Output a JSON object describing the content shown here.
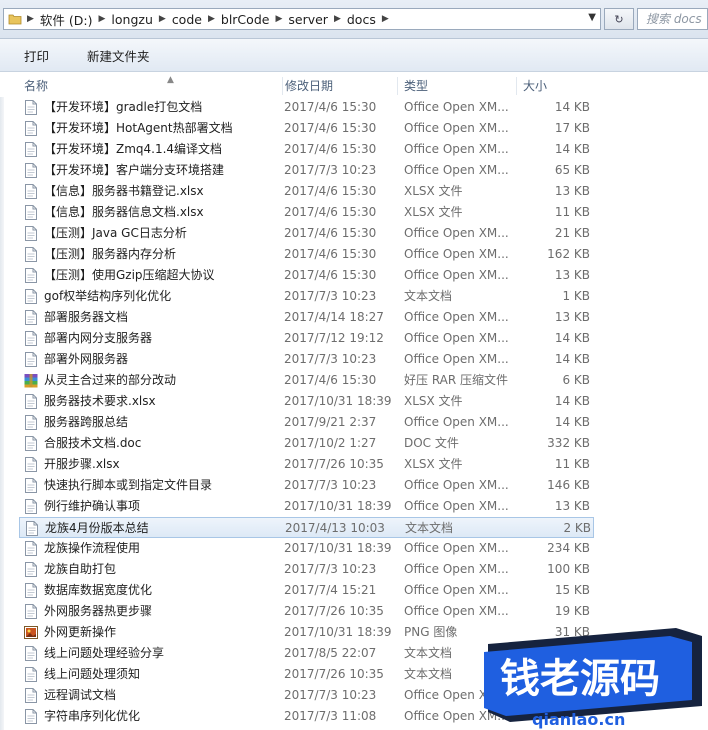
{
  "address": {
    "crumbs": [
      "软件 (D:)",
      "longzu",
      "code",
      "blrCode",
      "server",
      "docs"
    ]
  },
  "search": {
    "placeholder": "搜索 docs"
  },
  "toolbar": {
    "print_label": "打印",
    "new_folder_label": "新建文件夹"
  },
  "columns": {
    "name": "名称",
    "date": "修改日期",
    "type": "类型",
    "size": "大小"
  },
  "files": [
    {
      "name": "【开发环境】gradle打包文档",
      "date": "2017/4/6 15:30",
      "type": "Office Open XM...",
      "size": "14 KB",
      "icon": "document-icon"
    },
    {
      "name": "【开发环境】HotAgent热部署文档",
      "date": "2017/4/6 15:30",
      "type": "Office Open XM...",
      "size": "17 KB",
      "icon": "document-icon"
    },
    {
      "name": "【开发环境】Zmq4.1.4编译文档",
      "date": "2017/4/6 15:30",
      "type": "Office Open XM...",
      "size": "14 KB",
      "icon": "document-icon"
    },
    {
      "name": "【开发环境】客户端分支环境搭建",
      "date": "2017/7/3 10:23",
      "type": "Office Open XM...",
      "size": "65 KB",
      "icon": "document-icon"
    },
    {
      "name": "【信息】服务器书籍登记.xlsx",
      "date": "2017/4/6 15:30",
      "type": "XLSX 文件",
      "size": "13 KB",
      "icon": "document-icon"
    },
    {
      "name": "【信息】服务器信息文档.xlsx",
      "date": "2017/4/6 15:30",
      "type": "XLSX 文件",
      "size": "11 KB",
      "icon": "document-icon"
    },
    {
      "name": "【压测】Java GC日志分析",
      "date": "2017/4/6 15:30",
      "type": "Office Open XM...",
      "size": "21 KB",
      "icon": "document-icon"
    },
    {
      "name": "【压测】服务器内存分析",
      "date": "2017/4/6 15:30",
      "type": "Office Open XM...",
      "size": "162 KB",
      "icon": "document-icon"
    },
    {
      "name": "【压测】使用Gzip压缩超大协议",
      "date": "2017/4/6 15:30",
      "type": "Office Open XM...",
      "size": "13 KB",
      "icon": "document-icon"
    },
    {
      "name": "gof权举结构序列化优化",
      "date": "2017/7/3 10:23",
      "type": "文本文档",
      "size": "1 KB",
      "icon": "document-icon"
    },
    {
      "name": "部署服务器文档",
      "date": "2017/4/14 18:27",
      "type": "Office Open XM...",
      "size": "13 KB",
      "icon": "document-icon"
    },
    {
      "name": "部署内网分支服务器",
      "date": "2017/7/12 19:12",
      "type": "Office Open XM...",
      "size": "14 KB",
      "icon": "document-icon"
    },
    {
      "name": "部署外网服务器",
      "date": "2017/7/3 10:23",
      "type": "Office Open XM...",
      "size": "14 KB",
      "icon": "document-icon"
    },
    {
      "name": "从灵主合过来的部分改动",
      "date": "2017/4/6 15:30",
      "type": "好压 RAR 压缩文件",
      "size": "6 KB",
      "icon": "archive-icon"
    },
    {
      "name": "服务器技术要求.xlsx",
      "date": "2017/10/31 18:39",
      "type": "XLSX 文件",
      "size": "14 KB",
      "icon": "document-icon"
    },
    {
      "name": "服务器跨服总结",
      "date": "2017/9/21 2:37",
      "type": "Office Open XM...",
      "size": "14 KB",
      "icon": "document-icon"
    },
    {
      "name": "合服技术文档.doc",
      "date": "2017/10/2 1:27",
      "type": "DOC 文件",
      "size": "332 KB",
      "icon": "document-icon"
    },
    {
      "name": "开服步骤.xlsx",
      "date": "2017/7/26 10:35",
      "type": "XLSX 文件",
      "size": "11 KB",
      "icon": "document-icon"
    },
    {
      "name": "快速执行脚本或到指定文件目录",
      "date": "2017/7/3 10:23",
      "type": "Office Open XM...",
      "size": "146 KB",
      "icon": "document-icon"
    },
    {
      "name": "例行维护确认事项",
      "date": "2017/10/31 18:39",
      "type": "Office Open XM...",
      "size": "13 KB",
      "icon": "document-icon"
    },
    {
      "name": "龙族4月份版本总结",
      "date": "2017/4/13 10:03",
      "type": "文本文档",
      "size": "2 KB",
      "icon": "document-icon",
      "selected": true
    },
    {
      "name": "龙族操作流程使用",
      "date": "2017/10/31 18:39",
      "type": "Office Open XM...",
      "size": "234 KB",
      "icon": "document-icon"
    },
    {
      "name": "龙族自助打包",
      "date": "2017/7/3 10:23",
      "type": "Office Open XM...",
      "size": "100 KB",
      "icon": "document-icon"
    },
    {
      "name": "数据库数据宽度优化",
      "date": "2017/7/4 15:21",
      "type": "Office Open XM...",
      "size": "15 KB",
      "icon": "document-icon"
    },
    {
      "name": "外网服务器热更步骤",
      "date": "2017/7/26 10:35",
      "type": "Office Open XM...",
      "size": "19 KB",
      "icon": "document-icon"
    },
    {
      "name": "外网更新操作",
      "date": "2017/10/31 18:39",
      "type": "PNG 图像",
      "size": "31 KB",
      "icon": "image-icon"
    },
    {
      "name": "线上问题处理经验分享",
      "date": "2017/8/5 22:07",
      "type": "文本文档",
      "size": "",
      "icon": "document-icon"
    },
    {
      "name": "线上问题处理须知",
      "date": "2017/7/26 10:35",
      "type": "文本文档",
      "size": "",
      "icon": "document-icon"
    },
    {
      "name": "远程调试文档",
      "date": "2017/7/3 10:23",
      "type": "Office Open XM...",
      "size": "",
      "icon": "document-icon"
    },
    {
      "name": "字符串序列化优化",
      "date": "2017/7/3 11:08",
      "type": "Office Open XM...",
      "size": "",
      "icon": "document-icon"
    }
  ],
  "watermark": {
    "brand": "钱老源码",
    "site": "qianlao.cn"
  },
  "colors": {
    "selection": "#dde9f6",
    "watermark_blue": "#1f5fe0",
    "watermark_navy": "#16233f"
  }
}
